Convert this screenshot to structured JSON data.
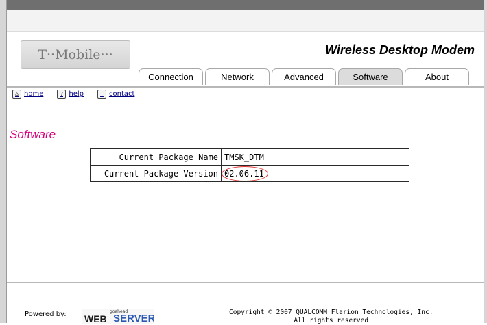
{
  "header": {
    "logo_text": "T··Mobile···",
    "brand_title": "Wireless Desktop Modem"
  },
  "tabs": [
    {
      "label": "Connection"
    },
    {
      "label": "Network"
    },
    {
      "label": "Advanced"
    },
    {
      "label": "Software",
      "active": true
    },
    {
      "label": "About"
    }
  ],
  "quick_links": [
    {
      "label": "home",
      "icon": "home-icon"
    },
    {
      "label": "help",
      "icon": "help-icon"
    },
    {
      "label": "contact",
      "icon": "contact-icon"
    }
  ],
  "page_title": "Software",
  "info_table": {
    "package_name_label": "Current Package Name",
    "package_name_value": "TMSK_DTM",
    "package_version_label": "Current Package Version",
    "package_version_value": "02.06.11"
  },
  "footer": {
    "powered_by": "Powered by:",
    "webserver_small": "goahead",
    "webserver_web": "WEB",
    "webserver_server": "SERVER",
    "copyright_line1": "Copyright © 2007 QUALCOMM Flarion Technologies, Inc.",
    "copyright_line2": "All rights reserved"
  },
  "colors": {
    "brand_magenta": "#d6007e",
    "active_tab": "#dcdcdc",
    "annotation_circle": "#e03030"
  }
}
